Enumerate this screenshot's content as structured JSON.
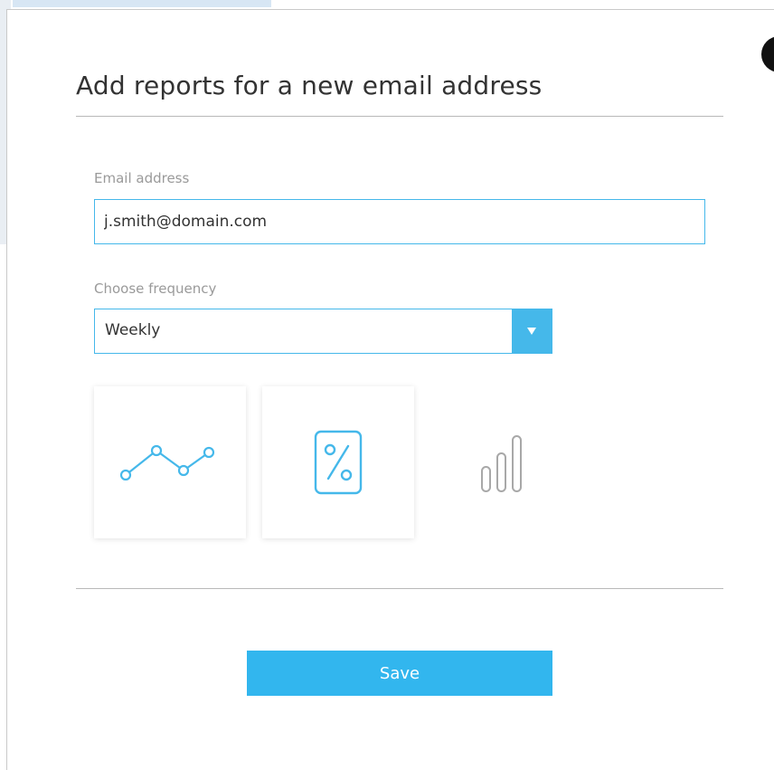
{
  "modal": {
    "title": "Add reports for a new email address"
  },
  "email": {
    "label": "Email address",
    "value": "j.smith@domain.com"
  },
  "frequency": {
    "label": "Choose frequency",
    "selected": "Weekly"
  },
  "report_types": [
    {
      "icon": "line-chart-icon",
      "selected": true
    },
    {
      "icon": "percent-tag-icon",
      "selected": true
    },
    {
      "icon": "bar-chart-icon",
      "selected": false
    }
  ],
  "actions": {
    "save_label": "Save"
  },
  "colors": {
    "accent": "#45b8ea",
    "button": "#32b6ee",
    "text": "#333333",
    "muted": "#9a9a9a",
    "icon_inactive": "#a8a8a8"
  }
}
